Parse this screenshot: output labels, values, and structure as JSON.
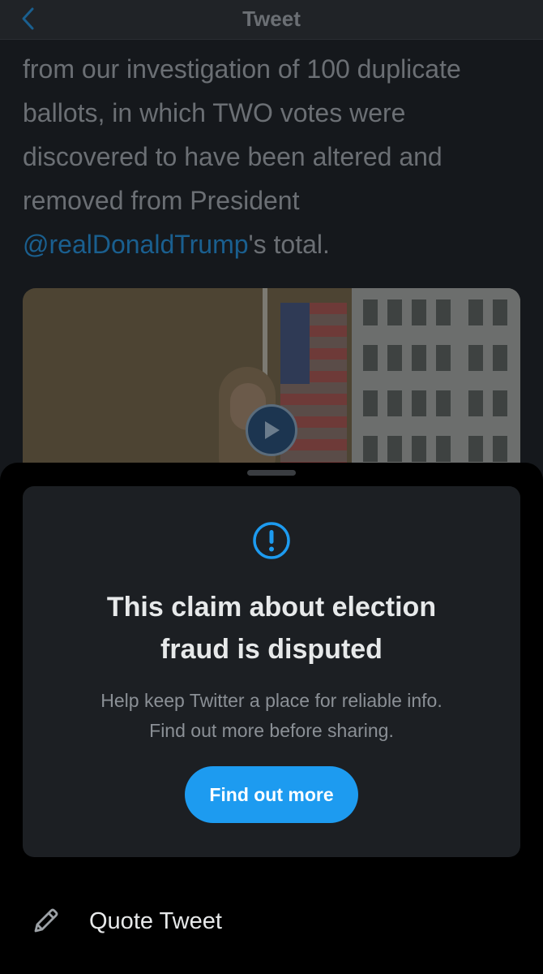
{
  "navbar": {
    "title": "Tweet",
    "back_icon": "chevron-left-icon"
  },
  "tweet": {
    "lines": [
      "from our investigation of 100 duplicate",
      "ballots, in which TWO votes were",
      "discovered to have been altered and",
      "removed from President"
    ],
    "mention": "@realDonaldTrump",
    "mention_suffix": "'s total."
  },
  "media": {
    "play_icon": "play-icon"
  },
  "warning_card": {
    "icon": "exclamation-circle-icon",
    "title_line1": "This claim about election",
    "title_line2": "fraud is disputed",
    "body_line1": "Help keep Twitter a place for reliable info.",
    "body_line2": "Find out more before sharing.",
    "button_label": "Find out more"
  },
  "actions": {
    "quote_tweet_label": "Quote Tweet",
    "quote_icon": "pencil-icon"
  },
  "colors": {
    "accent": "#1d9bf0",
    "sheet_background": "#000000",
    "card_background": "#1c1f23"
  }
}
